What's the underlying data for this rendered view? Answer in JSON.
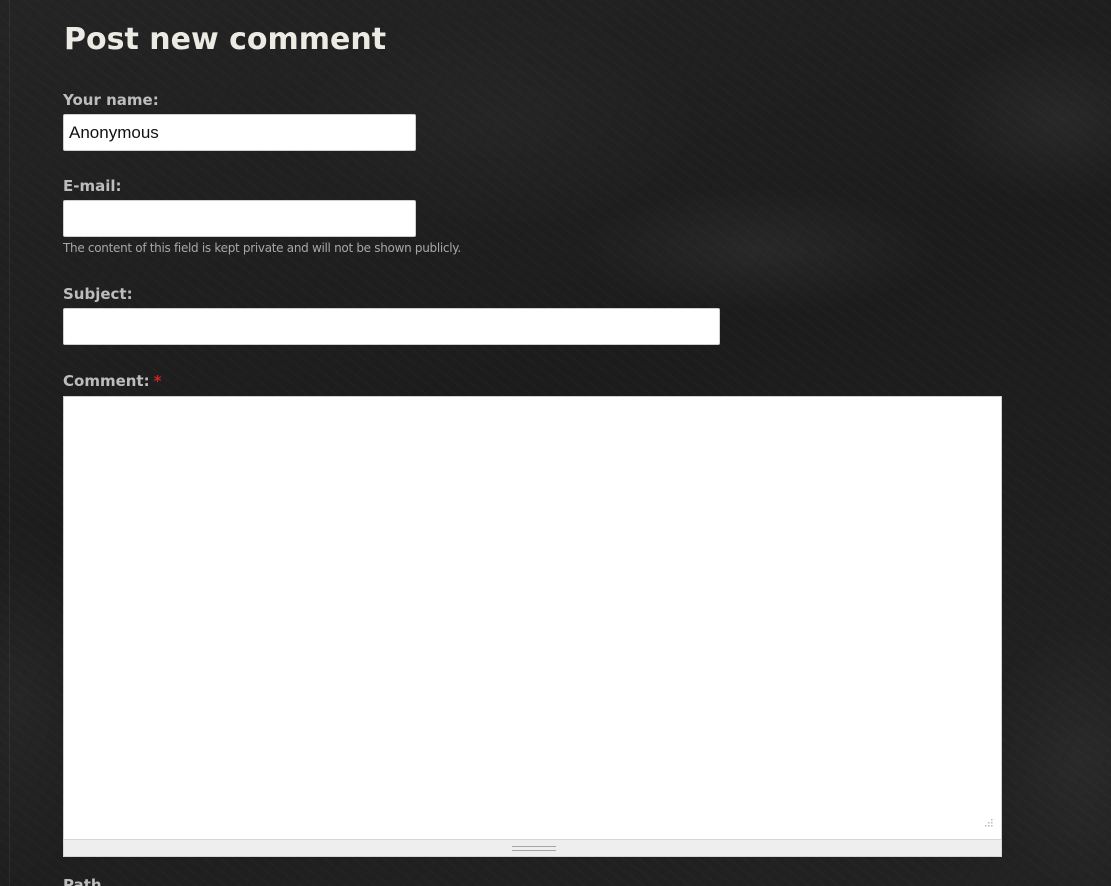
{
  "form": {
    "title": "Post new comment",
    "name": {
      "label": "Your name:",
      "value": "Anonymous"
    },
    "email": {
      "label": "E-mail:",
      "value": "",
      "description": "The content of this field is kept private and will not be shown publicly."
    },
    "subject": {
      "label": "Subject:",
      "value": ""
    },
    "comment": {
      "label": "Comment:",
      "required_marker": "*",
      "value": ""
    },
    "next_label_partial": "Path"
  },
  "colors": {
    "background": "#1f1f1f",
    "title": "#ecebe3",
    "label": "#bdbdbd",
    "description": "#a7a7a7",
    "required": "#d32424",
    "input_background": "#ffffff"
  }
}
